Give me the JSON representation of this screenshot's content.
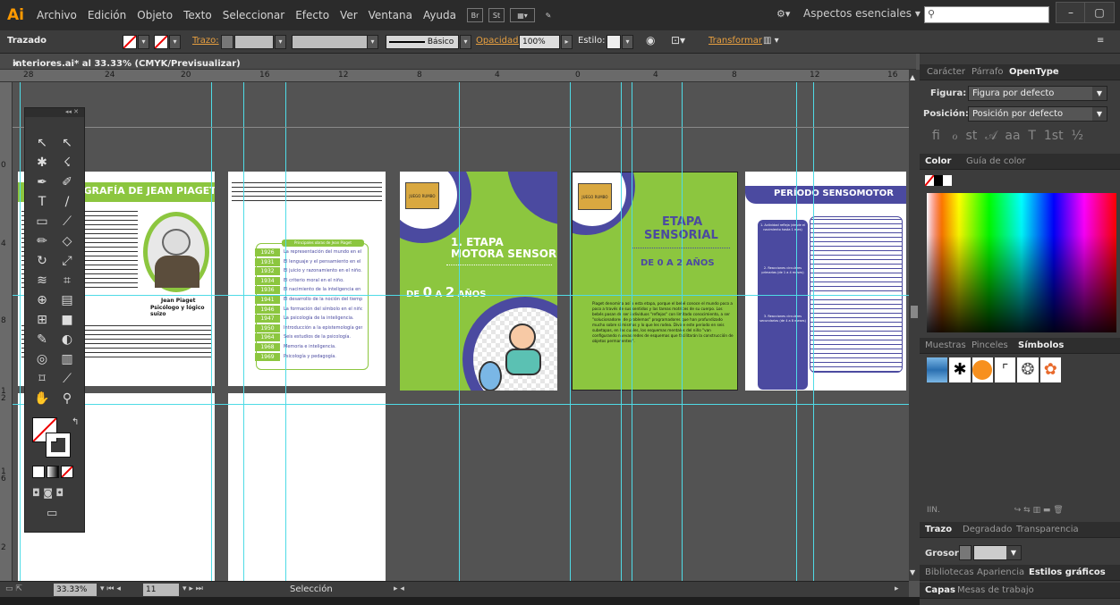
{
  "app": {
    "logo": "Ai",
    "menu": [
      "Archivo",
      "Edición",
      "Objeto",
      "Texto",
      "Seleccionar",
      "Efecto",
      "Ver",
      "Ventana",
      "Ayuda"
    ],
    "bridge": "Br",
    "stock": "St",
    "workspace": "Aspectos esenciales",
    "min": "–",
    "max": "▢",
    "close": "✕"
  },
  "control": {
    "selection_type": "Trazado",
    "stroke_label": "Trazo:",
    "brush": "Básico",
    "opacity_label": "Opacidad:",
    "opacity": "100%",
    "style_label": "Estilo:",
    "transform": "Transformar"
  },
  "document": {
    "tab_title": "interiores.ai* al 33.33% (CMYK/Previsualizar)",
    "tab_close": "×"
  },
  "ruler": {
    "h": [
      "28",
      "24",
      "20",
      "16",
      "12",
      "8",
      "4",
      "0",
      "4",
      "8",
      "12",
      "16"
    ],
    "v": [
      "0",
      "4",
      "8",
      "1\n2",
      "1\n6",
      "2"
    ]
  },
  "artboards": {
    "a1": {
      "title": "IOGRAFÍA DE JEAN PIAGET",
      "caption_name": "Jean Piaget",
      "caption_role": "Psicólogo y lógico suizo"
    },
    "a2": {
      "heading": "Principales obras de Jean Piaget",
      "timeline": [
        {
          "year": "1926",
          "event": "La representación del mundo en el niño."
        },
        {
          "year": "1931",
          "event": "El lenguaje y el pensamiento en el niño."
        },
        {
          "year": "1932",
          "event": "El juicio y razonamiento en el niño."
        },
        {
          "year": "1934",
          "event": "El criterio moral en el niño."
        },
        {
          "year": "1936",
          "event": "El nacimiento de la inteligencia en el niño."
        },
        {
          "year": "1941",
          "event": "El desarrollo de la noción del tiempo."
        },
        {
          "year": "1946",
          "event": "La formación del símbolo en el niño."
        },
        {
          "year": "1947",
          "event": "La psicología de la inteligencia."
        },
        {
          "year": "1950",
          "event": "Introducción a la epistemología genética."
        },
        {
          "year": "1964",
          "event": "Seis estudios de la psicología."
        },
        {
          "year": "1968",
          "event": "Memoria e inteligencia."
        },
        {
          "year": "1969",
          "event": "Psicología y pedagogía."
        }
      ]
    },
    "a3": {
      "title1": "1. ETAPA",
      "title2": "MOTORA SENSORIAL",
      "age_prefix": "DE ",
      "age_a": "0",
      "age_mid": " A ",
      "age_b": "2",
      "age_suffix": " AÑOS",
      "logo_text": "JUEGO RUMBO"
    },
    "a4": {
      "title1": "ETAPA",
      "title2": "SENSORIAL",
      "age": "DE 0 A 2 AÑOS",
      "body": "Piaget denomina así a esta etapa, porque el bebé conoce el mundo poco a poco a través de sus sentidos y las tareas motrices de su cuerpo. Los bebés pasan de ser individuos \"reflejos\" con limitado conocimiento, a ser \"solucionadores de problemas\" programadores que han profundizado mucho sobre sí mismos y lo que les rodea. Divide este periodo en seis subetapas, en las cuales, los esquemas mentales del niño \"van configurando nuevas redes de esquemas que facilitarán la construcción de objetos permanentes\"."
    },
    "a5": {
      "title": "PERÍODO SENSOMOTOR",
      "stages": [
        "1. Actividad refleja (desde el nacimiento hasta 1 mes)",
        "2. Reacciones circulares primarias (de 1 a 4 meses)",
        "3. Reacciones circulares secundarias (de 4 a 8 meses)"
      ]
    }
  },
  "status": {
    "zoom": "33.33%",
    "page": "11",
    "tool": "Selección"
  },
  "panels": {
    "char_tabs": [
      "Carácter",
      "Párrafo",
      "OpenType"
    ],
    "figure_label": "Figura:",
    "figure_value": "Figura por defecto",
    "position_label": "Posición:",
    "position_value": "Posición por defecto",
    "color_tabs": [
      "Color",
      "Guía de color"
    ],
    "symbol_tabs": [
      "Muestras",
      "Pinceles",
      "Símbolos"
    ],
    "stroke_tabs": [
      "Trazo",
      "Degradado",
      "Transparencia"
    ],
    "weight_label": "Grosor:",
    "lib_tabs": [
      "Bibliotecas",
      "Apariencia",
      "Estilos gráficos"
    ],
    "layer_tabs": [
      "Capas",
      "Mesas de trabajo"
    ]
  }
}
